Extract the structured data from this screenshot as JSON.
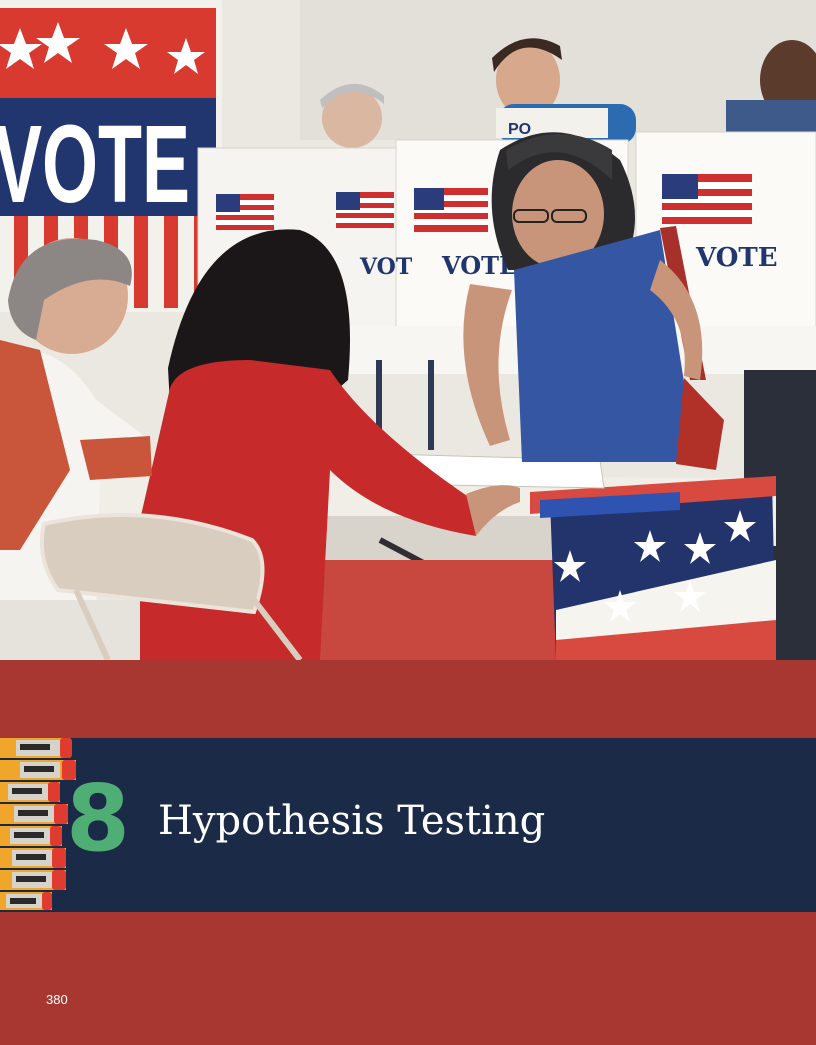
{
  "chapter": {
    "number": "8",
    "title": "Hypothesis Testing"
  },
  "page": {
    "number": "380"
  },
  "photo": {
    "poster_text": "VOTE",
    "booth_label": "VOTE",
    "booth_label_partial": "VOT",
    "sign_partial": "PO"
  },
  "colors": {
    "band_red": "#a93731",
    "band_navy": "#1b2a47",
    "chapter_number_green": "#4fae74"
  }
}
